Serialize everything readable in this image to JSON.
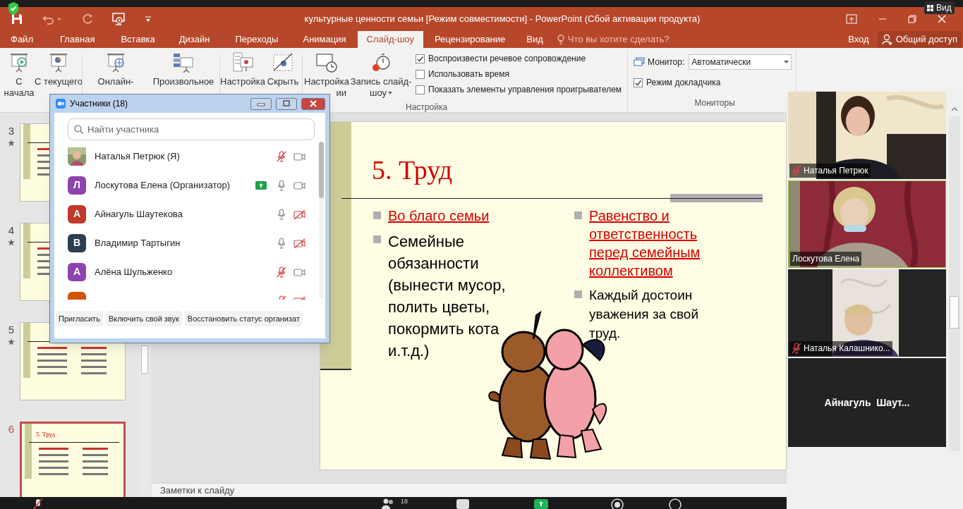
{
  "window": {
    "title": "культурные ценности семьи [Режим совместимости] - PowerPoint (Сбой активации продукта)"
  },
  "view_button": {
    "label": "Вид"
  },
  "tabs": [
    {
      "label": "Файл",
      "selected": false
    },
    {
      "label": "Главная",
      "selected": false
    },
    {
      "label": "Вставка",
      "selected": false
    },
    {
      "label": "Дизайн",
      "selected": false
    },
    {
      "label": "Переходы",
      "selected": false
    },
    {
      "label": "Анимация",
      "selected": false
    },
    {
      "label": "Слайд-шоу",
      "selected": true
    },
    {
      "label": "Рецензирование",
      "selected": false
    },
    {
      "label": "Вид",
      "selected": false
    }
  ],
  "tell_me": {
    "placeholder": "Что вы хотите сделать?"
  },
  "account": {
    "sign_in": "Вход",
    "share": "Общий доступ"
  },
  "ribbon": {
    "buttons": [
      {
        "kind": "play",
        "lines": [
          "С",
          "начала"
        ]
      },
      {
        "kind": "current",
        "lines": [
          "С текущего"
        ]
      },
      {
        "kind": "online",
        "lines": [
          "Онлайн-"
        ]
      },
      {
        "kind": "custom",
        "lines": [
          "Произвольное"
        ]
      },
      {
        "kind": "setup",
        "lines": [
          "Настройка"
        ]
      },
      {
        "kind": "hide",
        "lines": [
          "Скрыть"
        ]
      },
      {
        "kind": "timing",
        "lines": [
          "Настройка",
          "ии"
        ]
      },
      {
        "kind": "record",
        "lines": [
          "Запись слайд-",
          "шоу"
        ],
        "dropdown": true
      }
    ],
    "options": [
      {
        "label": "Воспроизвести речевое сопровождение",
        "checked": true
      },
      {
        "label": "Использовать время",
        "checked": false
      },
      {
        "label": "Показать элементы управления проигрывателем",
        "checked": false
      }
    ],
    "setup_group": "Настройка",
    "monitor": {
      "label": "Монитор:",
      "value": "Автоматически"
    },
    "presenter_view": {
      "label": "Режим докладчика",
      "checked": true
    },
    "monitors_group": "Мониторы"
  },
  "thumbnails": [
    {
      "number": "3",
      "animated": true,
      "selected": false
    },
    {
      "number": "4",
      "animated": true,
      "selected": false
    },
    {
      "number": "5",
      "animated": true,
      "selected": false
    },
    {
      "number": "6",
      "animated": false,
      "selected": true,
      "title": "5. Труд"
    }
  ],
  "slide": {
    "title": "5. Труд",
    "left_bullets": [
      {
        "text": "Во благо семьи",
        "kind": "link"
      },
      {
        "text": "Семейные обязанности (вынести мусор, полить цветы, покормить кота и.т.д.)",
        "kind": "plain"
      }
    ],
    "right_bullets": [
      {
        "text": "Равенство и ответственность перед семейным коллективом",
        "kind": "link"
      },
      {
        "text": "Каждый достоин уважения за свой труд.",
        "kind": "plain"
      }
    ]
  },
  "notes": {
    "placeholder": "Заметки к слайду"
  },
  "participants_window": {
    "title": "Участники (18)",
    "search_placeholder": "Найти участника",
    "participants": [
      {
        "name": "Наталья Петрюк (Я)",
        "sharing": false,
        "mic_muted": true,
        "video_off": false
      },
      {
        "kind": "letter",
        "letter": "Л",
        "color": "#8e44ad",
        "name": "Лоскутова Елена (Организатор)",
        "sharing": true,
        "mic_muted": false,
        "video_off": false
      },
      {
        "kind": "letter",
        "letter": "А",
        "color": "#c0392b",
        "name": "Айнагуль Шаутекова",
        "sharing": false,
        "mic_muted": false,
        "video_off": true
      },
      {
        "kind": "letter",
        "letter": "В",
        "color": "#2c3e50",
        "name": "Владимир Тартыгин",
        "sharing": false,
        "mic_muted": false,
        "video_off": true
      },
      {
        "kind": "letter",
        "letter": "А",
        "color": "#8e44ad",
        "name": "Алёна Шульженко",
        "sharing": false,
        "mic_muted": true,
        "video_off": false
      },
      {
        "kind": "letter",
        "color": "#d35400",
        "sharing": false,
        "mic_muted": true,
        "video_off": true
      }
    ],
    "buttons": [
      "Пригласить",
      "Включить свой звук",
      "Восстановить статус организат"
    ]
  },
  "video_tiles": [
    {
      "kind": "video",
      "name": "Наталья Петрюк",
      "muted": true
    },
    {
      "kind": "video",
      "name": "Лоскутова Елена",
      "muted": false
    },
    {
      "kind": "video",
      "name": "Наталья Калашнико...",
      "muted": true
    },
    {
      "kind": "name_only",
      "name": "Айнагуль  Шаут..."
    }
  ],
  "meeting_toolbar": {
    "participant_count": "18"
  }
}
